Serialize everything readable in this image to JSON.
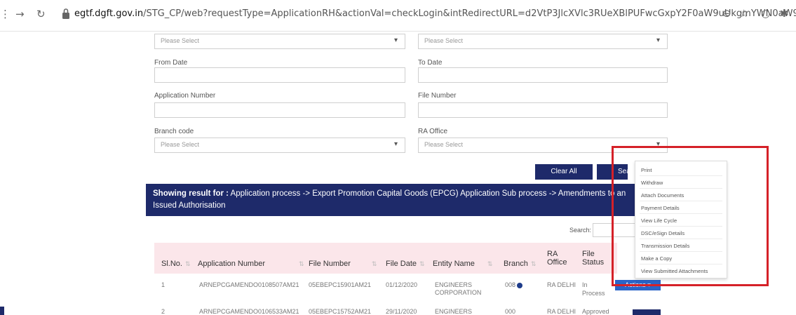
{
  "browser": {
    "url_domain": "egtf.dgft.gov.in",
    "url_rest": "/STG_CP/web?requestType=ApplicationRH&actionVal=checkLogin&intRedirectURL=d2VtP3JlcXVlc3RUeXBlPUFwcGxpY2F0aW9uUkgmYWN0aW9u..."
  },
  "form": {
    "top_left_select": "Please Select",
    "top_right_select": "Please Select",
    "from_date_label": "From Date",
    "to_date_label": "To Date",
    "app_number_label": "Application Number",
    "file_number_label": "File Number",
    "branch_code_label": "Branch code",
    "ra_office_label": "RA Office",
    "branch_select": "Please Select",
    "ra_select": "Please Select",
    "clear_label": "Clear All",
    "search_label": "Search"
  },
  "banner": {
    "prefix": "Showing result for :",
    "text": "Application process -> Export Promotion Capital Goods (EPCG) Application Sub process -> Amendments to an Issued Authorisation"
  },
  "table": {
    "search_label": "Search:",
    "headers": {
      "sl": "Sl.No.",
      "app": "Application Number",
      "file": "File Number",
      "date": "File Date",
      "entity": "Entity Name",
      "branch": "Branch",
      "ra1": "RA",
      "ra2": "Office",
      "fs1": "File",
      "fs2": "Status"
    },
    "row1": {
      "sl": "1",
      "app": "ARNEPCGAMENDO0108507AM21",
      "file": "05EBEPC15901AM21",
      "date": "01/12/2020",
      "entity1": "ENGINEERS",
      "entity2": "CORPORATION",
      "branch": "008",
      "ra": "RA DELHI",
      "status1": "In",
      "status2": "Process",
      "action": "Actions ▾"
    },
    "row2": {
      "sl": "2",
      "app": "ARNEPCGAMENDO0106533AM21",
      "file": "05EBEPC15752AM21",
      "date": "29/11/2020",
      "entity": "ENGINEERS",
      "branch": "000",
      "ra": "RA DELHI",
      "status": "Approved"
    }
  },
  "menu": {
    "items": [
      "Print",
      "Withdraw",
      "Attach Documents",
      "Payment Details",
      "View Life Cycle",
      "DSC/eSign Details",
      "Transmission Details",
      "Make a Copy",
      "View Submitted Attachments"
    ]
  },
  "colors": {
    "brand": "#1e2a6a",
    "highlight": "#d52128",
    "header_bg": "#fbe6ea"
  }
}
